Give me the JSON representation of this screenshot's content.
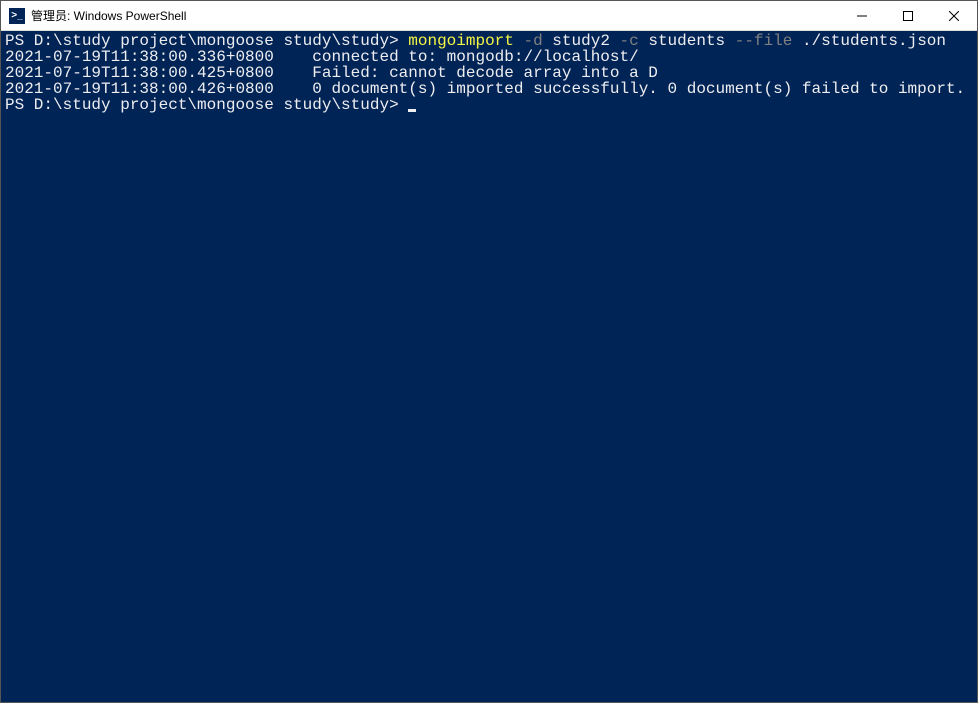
{
  "titlebar": {
    "icon_text": ">_",
    "title": "管理员: Windows PowerShell"
  },
  "terminal": {
    "prompt1": "PS D:\\study project\\mongoose study\\study> ",
    "cmd": "mongoimport",
    "flag_d": " -d",
    "arg_d": " study2",
    "flag_c": " -c",
    "arg_c": " students",
    "flag_file": " --file",
    "arg_file": " ./students.json",
    "line2": "2021-07-19T11:38:00.336+0800    connected to: mongodb://localhost/",
    "line3": "2021-07-19T11:38:00.425+0800    Failed: cannot decode array into a D",
    "line4": "2021-07-19T11:38:00.426+0800    0 document(s) imported successfully. 0 document(s) failed to import.",
    "prompt2": "PS D:\\study project\\mongoose study\\study> "
  }
}
